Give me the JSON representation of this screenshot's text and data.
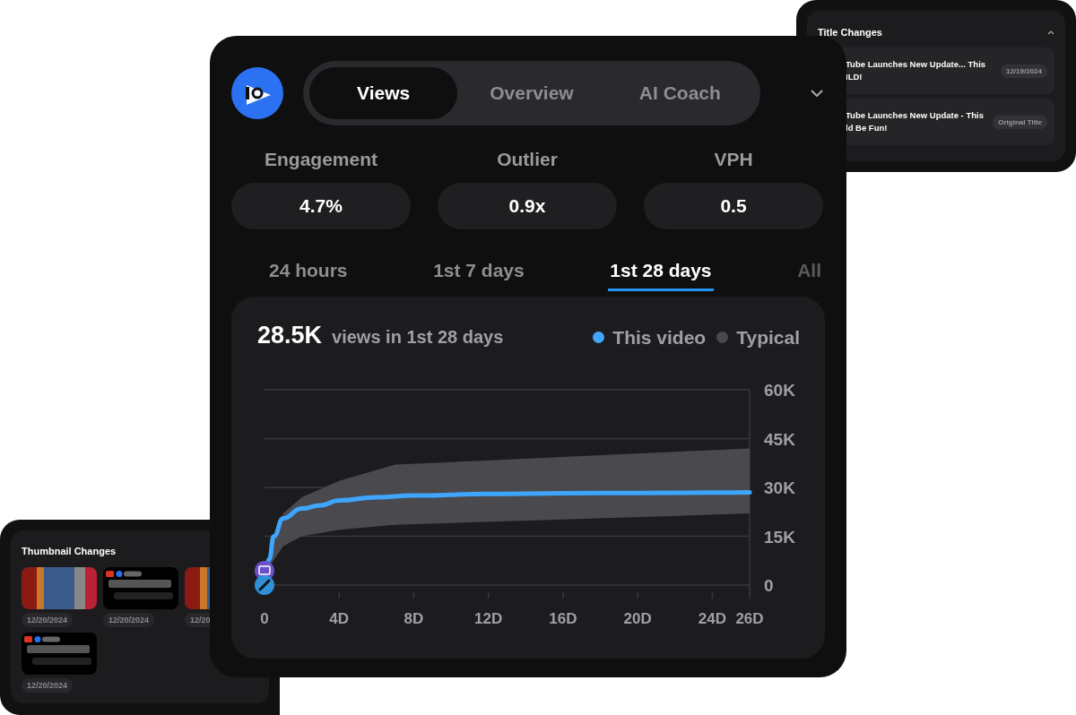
{
  "title_changes": {
    "title": "Title Changes",
    "rows": [
      {
        "lines": [
          "Tube Launches New Update... This",
          "ILD!"
        ],
        "badge": "12/19/2024"
      },
      {
        "lines": [
          "Tube Launches New Update - This",
          "ld Be Fun!"
        ],
        "badge": "Original Title"
      }
    ]
  },
  "thumbnail_changes": {
    "title": "Thumbnail Changes",
    "items": [
      {
        "kind": "photo",
        "date": "12/20/2024"
      },
      {
        "kind": "message",
        "date": "12/20/2024"
      },
      {
        "kind": "photo",
        "date": "12/20/"
      },
      {
        "kind": "message",
        "date": "12/20/2024"
      }
    ]
  },
  "tabs": [
    {
      "label": "Views",
      "selected": true
    },
    {
      "label": "Overview",
      "selected": false
    },
    {
      "label": "AI Coach",
      "selected": false
    }
  ],
  "metrics": [
    {
      "label": "Engagement",
      "value": "4.7%"
    },
    {
      "label": "Outlier",
      "value": "0.9x"
    },
    {
      "label": "VPH",
      "value": "0.5"
    }
  ],
  "ranges": [
    {
      "label": "24 hours",
      "selected": false
    },
    {
      "label": "1st 7 days",
      "selected": false
    },
    {
      "label": "1st 28 days",
      "selected": true
    },
    {
      "label": "All",
      "selected": false
    }
  ],
  "legend": [
    {
      "label": "Typical",
      "color": "#4a4a4e"
    }
  ],
  "summary": {
    "value": "28.5K",
    "caption": "views in 1st 28 days"
  },
  "chart_data": {
    "type": "line",
    "x": [
      0,
      0.25,
      0.5,
      1,
      2,
      3,
      4,
      6,
      8,
      12,
      16,
      20,
      24,
      26
    ],
    "series": [
      {
        "name": "This video",
        "color": "#3ea6ff",
        "values": [
          0,
          8000,
          15000,
          20500,
          23500,
          24500,
          26000,
          27000,
          27500,
          28000,
          28200,
          28300,
          28400,
          28500
        ]
      }
    ],
    "grid": true,
    "xlim": [
      0,
      26
    ],
    "ylim": [
      0,
      60000
    ],
    "xticks": [
      {
        "value": 0,
        "label": "0"
      },
      {
        "value": 4,
        "label": "4D"
      },
      {
        "value": 8,
        "label": "8D"
      },
      {
        "value": 12,
        "label": "12D"
      },
      {
        "value": 16,
        "label": "16D"
      },
      {
        "value": 20,
        "label": "20D"
      },
      {
        "value": 24,
        "label": "24D"
      },
      {
        "value": 26,
        "label": "26D"
      }
    ],
    "yticks": [
      {
        "value": 0,
        "label": "0"
      },
      {
        "value": 15000,
        "label": "15K"
      },
      {
        "value": 30000,
        "label": "30K"
      },
      {
        "value": 45000,
        "label": "45K"
      },
      {
        "value": 60000,
        "label": "60K"
      }
    ]
  }
}
